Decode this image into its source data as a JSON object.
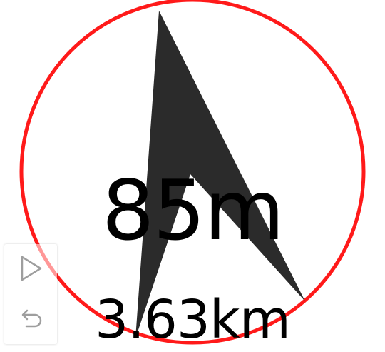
{
  "navigation": {
    "distance_to_next": "85m",
    "distance_total": "3.63km"
  },
  "controls": {
    "items": [
      {
        "name": "play-icon"
      },
      {
        "name": "undo-icon"
      }
    ]
  },
  "colors": {
    "ring": "#ff1a1a",
    "arrow": "#2b2b2b",
    "text": "#000000",
    "background": "#ffffff"
  }
}
